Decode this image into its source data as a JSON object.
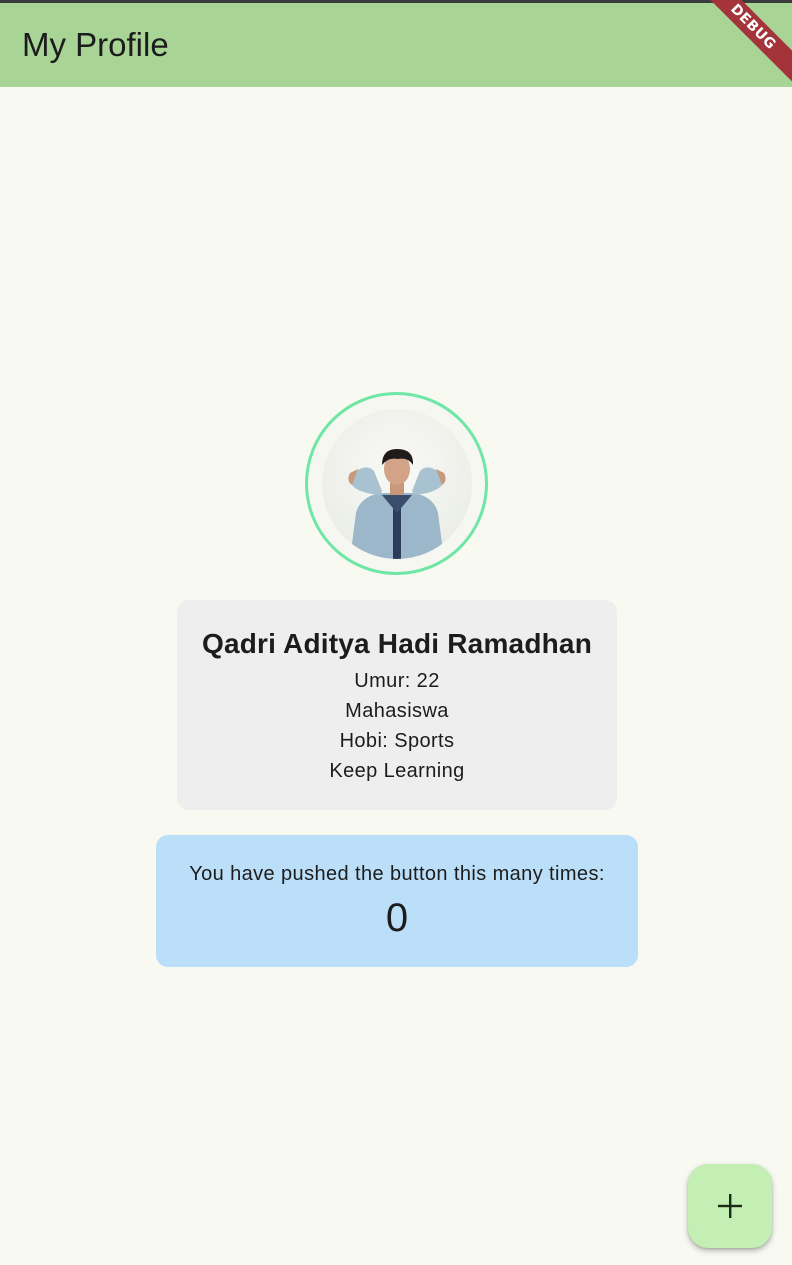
{
  "app_bar": {
    "title": "My Profile"
  },
  "debug_banner": {
    "label": "DEBUG"
  },
  "profile": {
    "name": "Qadri Aditya Hadi Ramadhan",
    "age": "Umur: 22",
    "occupation": "Mahasiswa",
    "hobby": "Hobi: Sports",
    "motto": "Keep Learning"
  },
  "counter": {
    "label": "You have pushed the button this many times:",
    "value": "0"
  },
  "fab": {
    "icon": "add-icon"
  },
  "colors": {
    "app_bar": "#a8d595",
    "background": "#f8f9f1",
    "avatar_ring": "#6ee6a4",
    "info_card": "#eeeeee",
    "counter_card": "#bcdff9",
    "fab": "#c4efb4",
    "debug_banner": "#a4333a"
  }
}
